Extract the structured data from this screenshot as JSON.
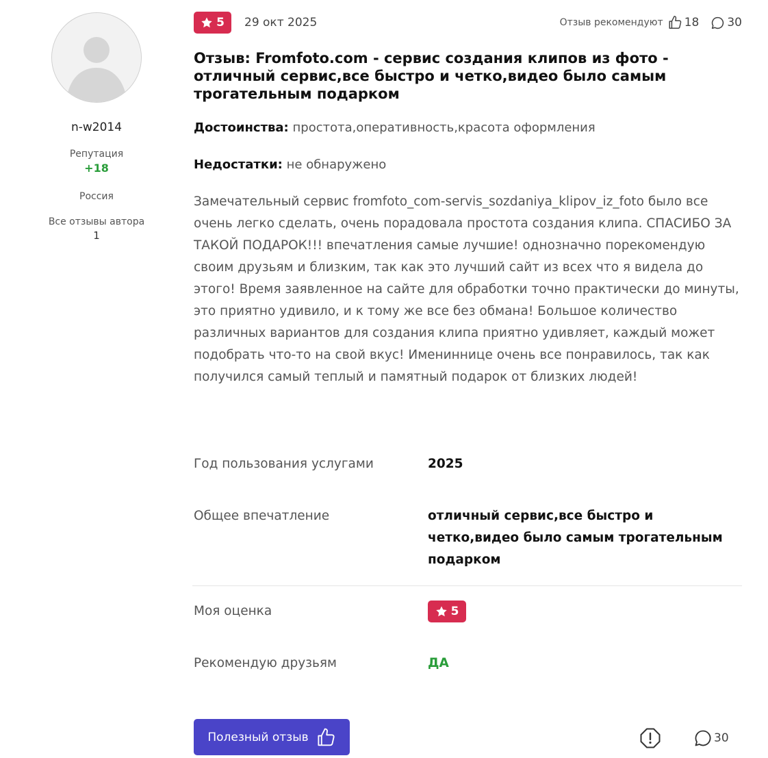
{
  "author": {
    "name": "n-w2014",
    "reputation_label": "Репутация",
    "reputation_value": "+18",
    "country": "Россия",
    "all_reviews_label": "Все отзывы автора",
    "all_reviews_count": "1"
  },
  "review": {
    "rating": "5",
    "date": "29 окт 2025",
    "recommend_label": "Отзыв рекомендуют",
    "likes": "18",
    "comments": "30",
    "title": "Отзыв: Fromfoto.com - сервис создания клипов из фото - отличный сервис,все быстро и четко,видео было самым трогательным подарком",
    "pros_label": "Достоинства:",
    "pros": "простота,оперативность,красота оформления",
    "cons_label": "Недостатки:",
    "cons": "не обнаружено",
    "body": "Замечательный сервис fromfoto_com-servis_sozdaniya_klipov_iz_foto было все очень легко сделать, очень порадовала простота создания клипа. СПАСИБО ЗА ТАКОЙ ПОДАРОК!!! впечатления самые лучшие! однозначно порекомендую своим друзьям и близким, так как это лучший сайт из всех что я видела до этого! Время заявленное на сайте для обработки точно практически до минуты, это приятно удивило, и к тому же все без обмана! Большое количество различных вариантов для создания клипа приятно удивляет, каждый может подобрать что-то на свой вкус! Имениннице очень все понравилось, так как получился самый теплый и памятный подарок от близких людей!"
  },
  "details": {
    "year_label": "Год пользования услугами",
    "year_value": "2025",
    "impression_label": "Общее впечатление",
    "impression_value": "отличный сервис,все быстро и четко,видео было самым трогательным подарком",
    "my_rating_label": "Моя оценка",
    "my_rating_value": "5",
    "recommend_label": "Рекомендую друзьям",
    "recommend_value": "ДА"
  },
  "footer": {
    "helpful_label": "Полезный отзыв",
    "comments": "30"
  },
  "colors": {
    "rating_badge": "#d72c50",
    "reputation": "#2a9d3a",
    "helpful_button": "#4a44c8"
  },
  "icons": [
    "user-avatar-icon",
    "star-icon",
    "thumbs-up-icon",
    "comment-icon",
    "report-icon"
  ]
}
